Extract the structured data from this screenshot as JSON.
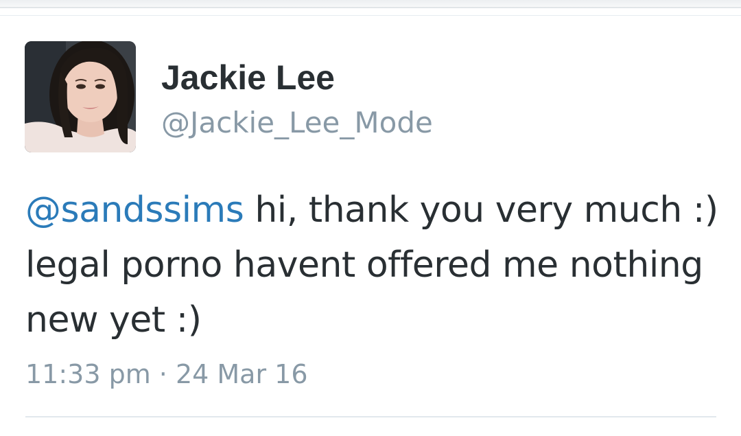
{
  "author": {
    "display_name": "Jackie Lee",
    "handle": "@Jackie_Lee_Mode",
    "avatar_icon": "profile-photo"
  },
  "tweet": {
    "mention": "@sandssims",
    "text": " hi, thank you very much :) legal porno havent offered me nothing new yet :)",
    "timestamp": "11:33 pm · 24 Mar 16"
  },
  "colors": {
    "text": "#292f33",
    "secondary": "#8899a6",
    "mention": "#2b7bb9",
    "divider": "#e1e8ed"
  }
}
